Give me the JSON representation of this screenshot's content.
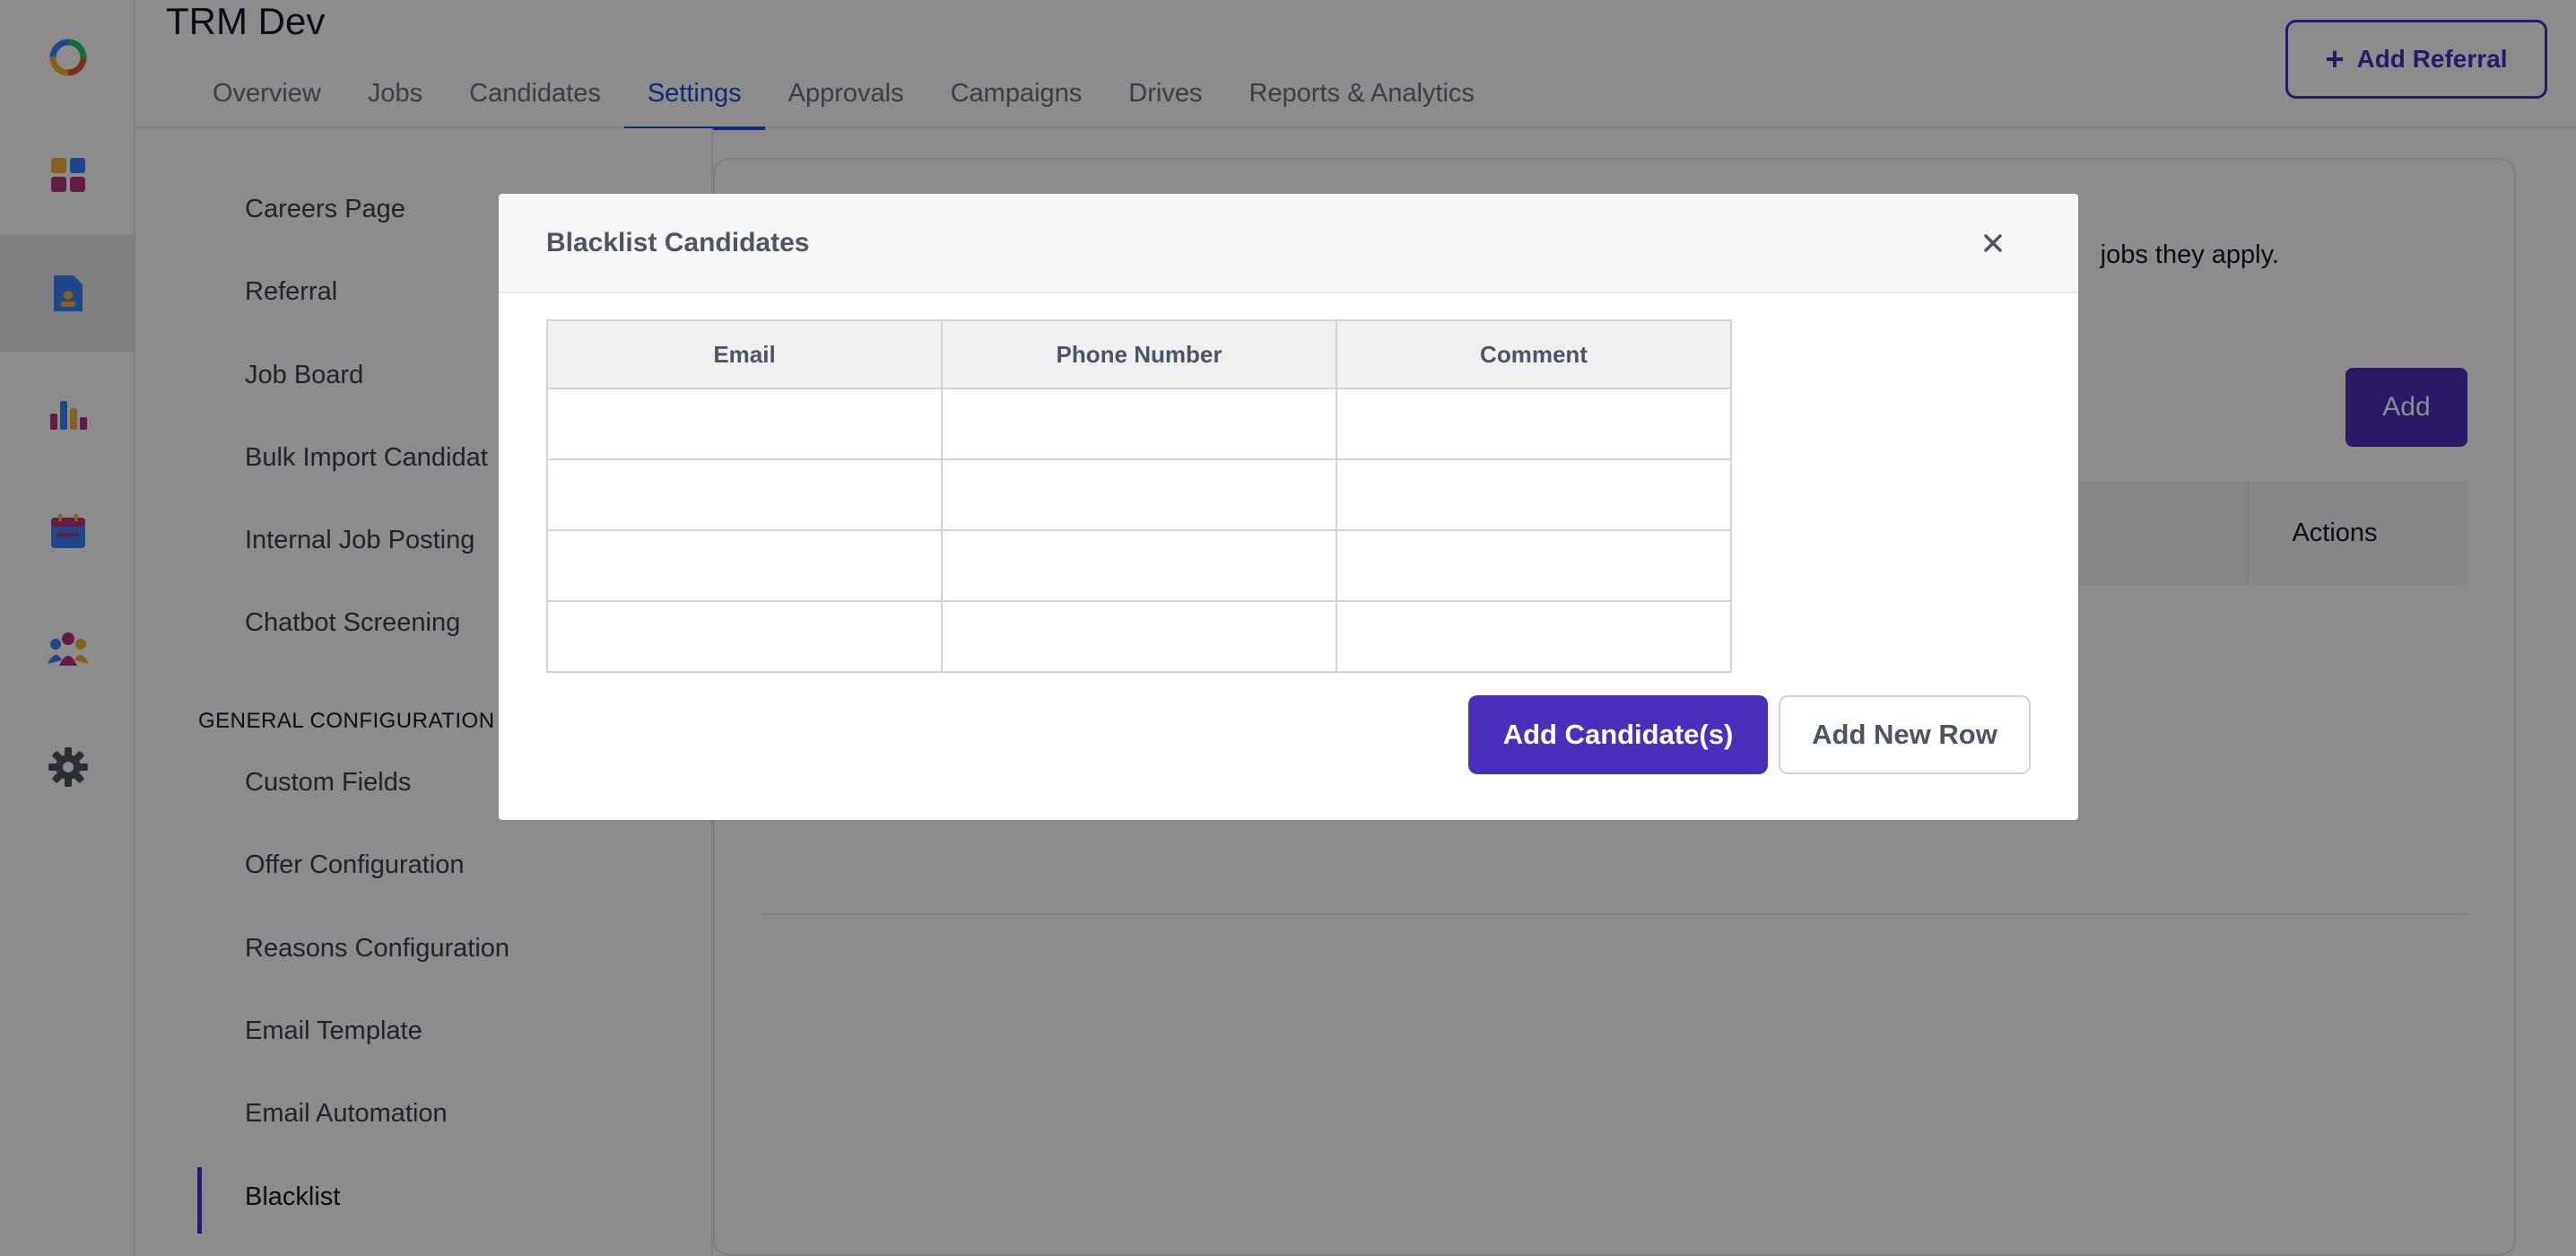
{
  "header": {
    "title": "TRM Dev",
    "add_referral": "Add Referral",
    "tabs": [
      {
        "label": "Overview"
      },
      {
        "label": "Jobs"
      },
      {
        "label": "Candidates"
      },
      {
        "label": "Settings",
        "active": true
      },
      {
        "label": "Approvals"
      },
      {
        "label": "Campaigns"
      },
      {
        "label": "Drives"
      },
      {
        "label": "Reports & Analytics"
      }
    ]
  },
  "rail": {
    "icons": [
      "logo-icon",
      "dashboard-icon",
      "document-icon",
      "bar-chart-icon",
      "calendar-icon",
      "people-icon",
      "gear-icon"
    ],
    "active": "document-icon"
  },
  "settings_nav": {
    "items_top": [
      "Careers Page",
      "Referral",
      "Job Board",
      "Bulk Import Candidat",
      "Internal Job Posting",
      "Chatbot Screening"
    ],
    "section_label": "GENERAL CONFIGURATION",
    "items_bottom": [
      "Custom Fields",
      "Offer Configuration",
      "Reasons Configuration",
      "Email Template",
      "Email Automation",
      "Blacklist"
    ],
    "active": "Blacklist"
  },
  "content": {
    "description": "jobs they apply.",
    "add_label": "Add",
    "actions_label": "Actions"
  },
  "modal": {
    "title": "Blacklist Candidates",
    "columns": [
      "Email",
      "Phone Number",
      "Comment"
    ],
    "row_count": 4,
    "primary_button": "Add Candidate(s)",
    "secondary_button": "Add New Row"
  },
  "colors": {
    "accent": "#4c2ebd",
    "tab_active": "#1d4ed8"
  }
}
